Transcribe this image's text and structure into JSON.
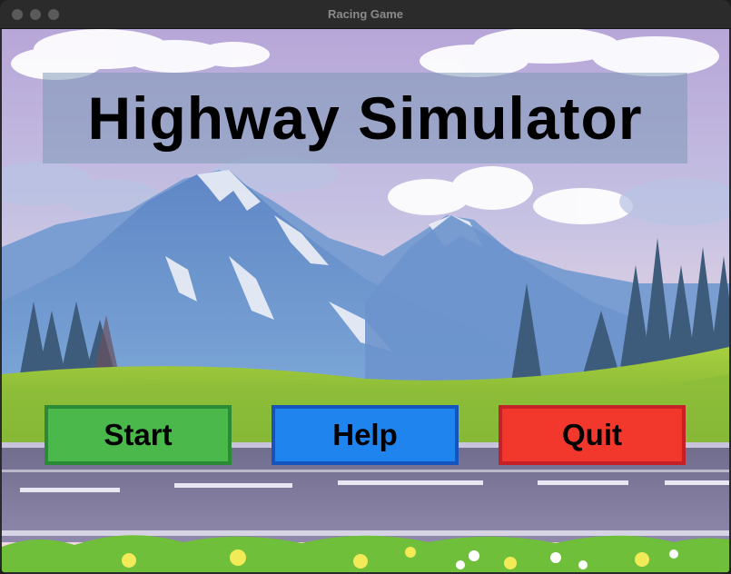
{
  "window": {
    "title": "Racing Game"
  },
  "scene": {
    "title": "Highway Simulator"
  },
  "buttons": {
    "start": "Start",
    "help": "Help",
    "quit": "Quit"
  },
  "colors": {
    "start_fill": "#4bb84c",
    "start_border": "#2a8a35",
    "help_fill": "#1f84ee",
    "help_border": "#1554bd",
    "quit_fill": "#f2382c",
    "quit_border": "#c32028"
  }
}
